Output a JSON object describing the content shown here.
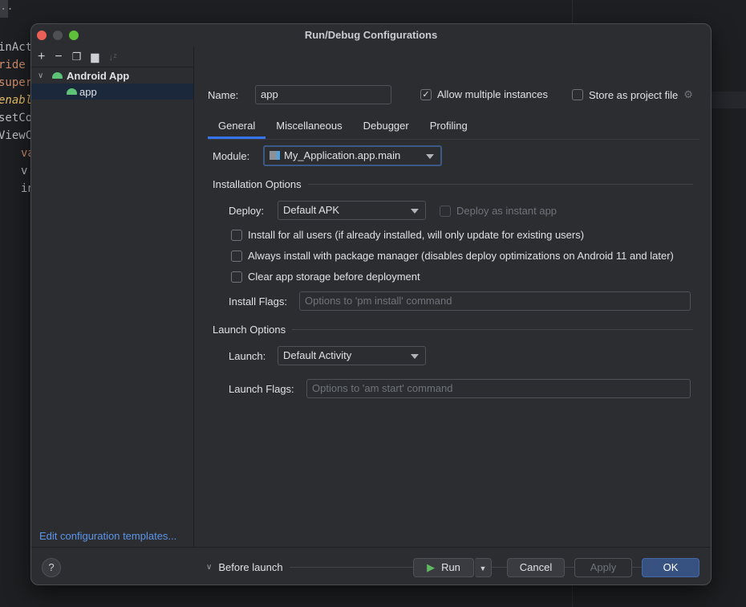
{
  "background_code": [
    "inAct",
    "ride",
    "super",
    "enable",
    "setCo",
    "ViewCo",
    "va",
    "v",
    "in"
  ],
  "dialog": {
    "title": "Run/Debug Configurations"
  },
  "sidebar": {
    "toolbar": [
      "add-icon",
      "remove-icon",
      "copy-icon",
      "new-folder-icon",
      "sort-icon"
    ],
    "tree": {
      "group": "Android App",
      "item": "app"
    },
    "templates_link": "Edit configuration templates..."
  },
  "name": {
    "label": "Name:",
    "value": "app"
  },
  "allow_multiple": {
    "label": "Allow multiple instances",
    "checked": true
  },
  "store_project": {
    "label": "Store as project file",
    "checked": false
  },
  "tabs": [
    {
      "label": "General",
      "active": true
    },
    {
      "label": "Miscellaneous"
    },
    {
      "label": "Debugger"
    },
    {
      "label": "Profiling"
    }
  ],
  "module": {
    "label": "Module:",
    "value": "My_Application.app.main"
  },
  "installation": {
    "title": "Installation Options",
    "deploy_label": "Deploy:",
    "deploy_value": "Default APK",
    "instant_app": "Deploy as instant app",
    "checks": [
      "Install for all users (if already installed, will only update for existing users)",
      "Always install with package manager (disables deploy optimizations on Android 11 and later)",
      "Clear app storage before deployment"
    ],
    "flags_label": "Install Flags:",
    "flags_placeholder": "Options to 'pm install' command"
  },
  "launch": {
    "title": "Launch Options",
    "launch_label": "Launch:",
    "launch_value": "Default Activity",
    "flags_label": "Launch Flags:",
    "flags_placeholder": "Options to 'am start' command"
  },
  "before_launch": "Before launch",
  "footer": {
    "help": "?",
    "run": "Run",
    "cancel": "Cancel",
    "apply": "Apply",
    "ok": "OK"
  },
  "colors": {
    "accent": "#3574f0",
    "ok_button": "#375180",
    "run_icon": "#5fb85f",
    "android": "#5dc277",
    "link": "#5d95e8"
  }
}
